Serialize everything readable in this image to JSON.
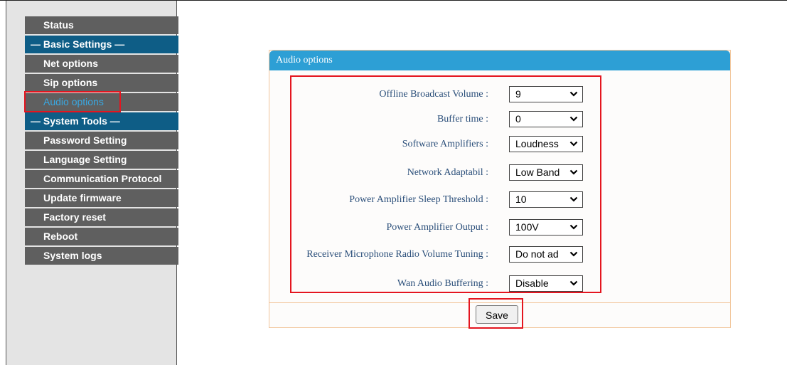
{
  "sidebar": {
    "items": [
      {
        "label": "Status",
        "type": "item"
      },
      {
        "label": "— Basic Settings —",
        "type": "section"
      },
      {
        "label": "Net options",
        "type": "item"
      },
      {
        "label": "Sip options",
        "type": "item"
      },
      {
        "label": "Audio options",
        "type": "item",
        "active": true
      },
      {
        "label": "— System Tools —",
        "type": "section"
      },
      {
        "label": "Password Setting",
        "type": "item"
      },
      {
        "label": "Language Setting",
        "type": "item"
      },
      {
        "label": "Communication Protocol",
        "type": "item"
      },
      {
        "label": "Update firmware",
        "type": "item"
      },
      {
        "label": "Factory reset",
        "type": "item"
      },
      {
        "label": "Reboot",
        "type": "item"
      },
      {
        "label": "System logs",
        "type": "item"
      }
    ]
  },
  "panel": {
    "title": "Audio options",
    "fields": [
      {
        "label": "Offline Broadcast Volume :",
        "value": "9"
      },
      {
        "label": "Buffer time :",
        "value": "0"
      },
      {
        "label": "Software Amplifiers :",
        "value": "Loudness"
      },
      {
        "label": "Network Adaptabil :",
        "value": "Low Band"
      },
      {
        "label": "Power Amplifier Sleep Threshold :",
        "value": "10"
      },
      {
        "label": "Power Amplifier Output :",
        "value": "100V"
      },
      {
        "label": "Receiver Microphone Radio Volume Tuning :",
        "value": "Do not ad"
      },
      {
        "label": "Wan Audio Buffering :",
        "value": "Disable"
      }
    ],
    "save_label": "Save"
  },
  "colors": {
    "nav_item_bg": "#5f5f5f",
    "nav_section_bg": "#0e5d86",
    "nav_active_text": "#39a7e0",
    "panel_header_bg": "#2d9fd5",
    "panel_border": "#f2c69b",
    "label_text": "#2b4f7a",
    "highlight_frame": "#e4151f"
  },
  "icons": {
    "select_arrow": "chevron-down-icon"
  }
}
